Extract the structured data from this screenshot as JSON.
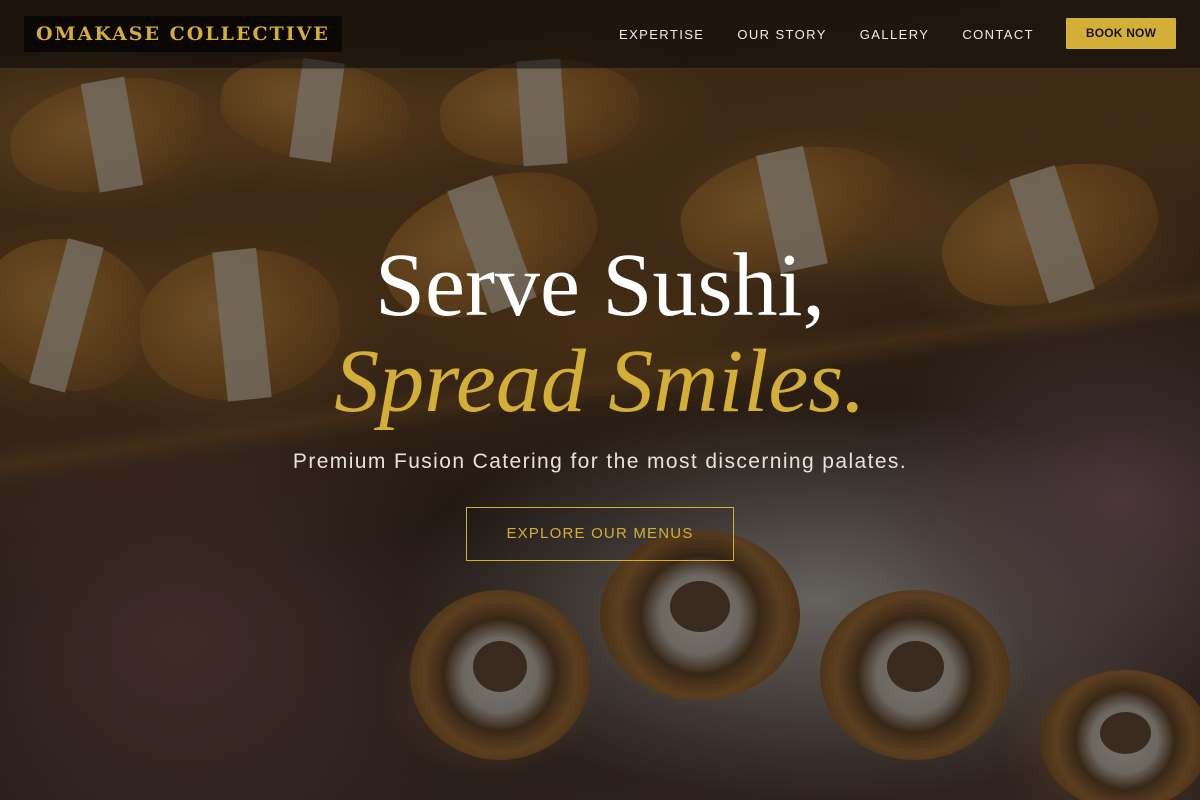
{
  "brand": {
    "logo_text": "OMAKASE COLLECTIVE"
  },
  "nav": {
    "items": [
      {
        "label": "EXPERTISE"
      },
      {
        "label": "OUR STORY"
      },
      {
        "label": "GALLERY"
      },
      {
        "label": "CONTACT"
      }
    ],
    "cta_label": "BOOK NOW"
  },
  "hero": {
    "headline_line1": "Serve Sushi,",
    "headline_line2": "Spread Smiles.",
    "subheading": "Premium Fusion Catering for the most discerning palates.",
    "button_label": "EXPLORE OUR MENUS",
    "background_image": "food-platter-photo"
  },
  "colors": {
    "accent": "#d4af37",
    "text_light": "#ffffff",
    "overlay": "#0a0806"
  }
}
